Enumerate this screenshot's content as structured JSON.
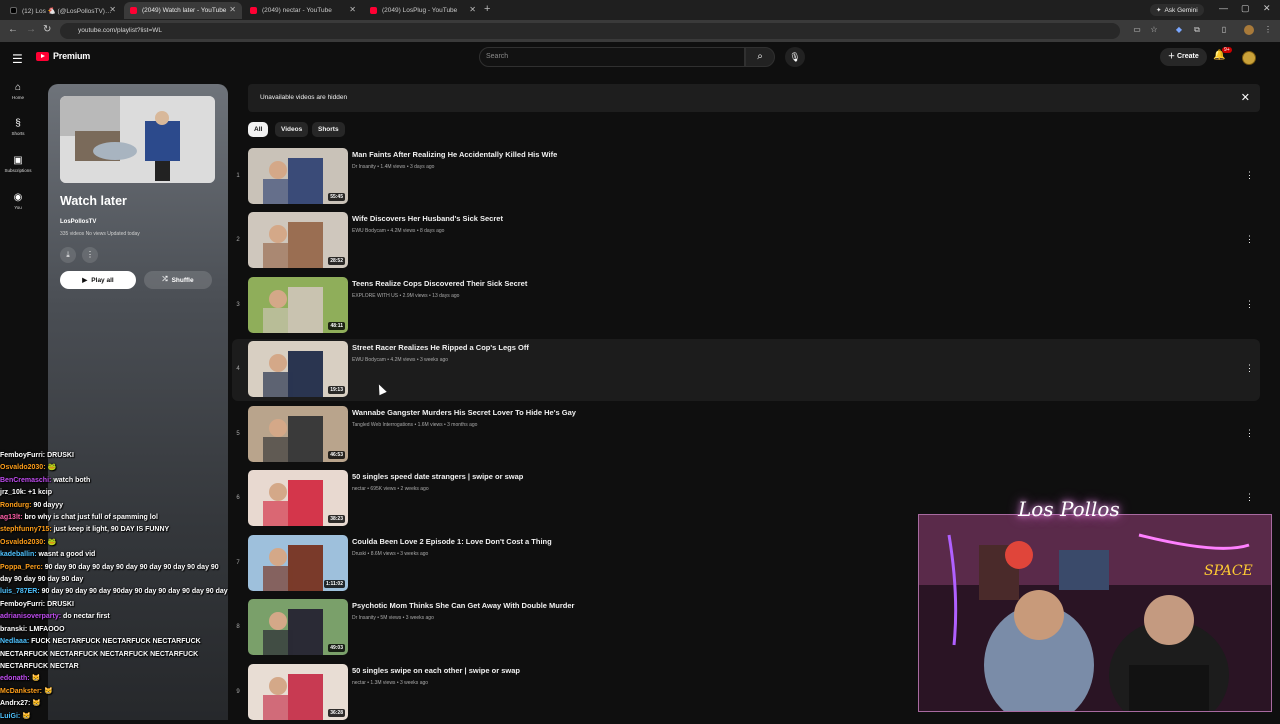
{
  "browser": {
    "tabs": [
      {
        "label": "(12) Los 🐔 (@LosPollosTV) / X",
        "favicon_color": "#000000",
        "active": false
      },
      {
        "label": "(2049) Watch later - YouTube",
        "favicon_color": "#ff0033",
        "active": true
      },
      {
        "label": "(2049) nectar - YouTube",
        "favicon_color": "#ff0033",
        "active": false
      },
      {
        "label": "(2049) LosPlug - YouTube",
        "favicon_color": "#ff0033",
        "active": false
      }
    ],
    "new_tab": "+",
    "ask_gemini": "Ask Gemini",
    "url": "youtube.com/playlist?list=WL"
  },
  "youtube": {
    "logo_text": "Premium",
    "search_placeholder": "Search",
    "create_label": "Create",
    "notifications_badge": "9+",
    "guide": [
      {
        "icon": "home-icon",
        "label": "Home"
      },
      {
        "icon": "shorts-icon",
        "label": "Shorts"
      },
      {
        "icon": "subscriptions-icon",
        "label": "Subscriptions"
      },
      {
        "icon": "you-icon",
        "label": "You"
      }
    ]
  },
  "playlist": {
    "title": "Watch later",
    "owner": "LosPollosTV",
    "meta": "335 videos  No views  Updated today",
    "play_all": "Play all",
    "shuffle": "Shuffle"
  },
  "banner": {
    "text": "Unavailable videos are hidden"
  },
  "chips": [
    "All",
    "Videos",
    "Shorts"
  ],
  "videos": [
    {
      "index": "1",
      "title": "Man Faints After Realizing He Accidentally Killed His Wife",
      "meta": "Dr Insanity • 1.4M views • 3 days ago",
      "duration": "55:45",
      "thumb_colors": [
        "#c9c2b8",
        "#3a4b78"
      ]
    },
    {
      "index": "2",
      "title": "Wife Discovers Her Husband's Sick Secret",
      "meta": "EWU Bodycam • 4.2M views • 8 days ago",
      "duration": "28:52",
      "thumb_colors": [
        "#cfc7bd",
        "#9a6e52"
      ]
    },
    {
      "index": "3",
      "title": "Teens Realize Cops Discovered Their Sick Secret",
      "meta": "EXPLORE WITH US • 2.9M views • 13 days ago",
      "duration": "48:11",
      "thumb_colors": [
        "#8fae5a",
        "#c9c3b0"
      ]
    },
    {
      "index": "4",
      "title": "Street Racer Realizes He Ripped a Cop's Legs Off",
      "meta": "EWU Bodycam • 4.2M views • 3 weeks ago",
      "duration": "19:13",
      "thumb_colors": [
        "#d8cfc2",
        "#2a3550"
      ]
    },
    {
      "index": "5",
      "title": "Wannabe Gangster Murders His Secret Lover To Hide He's Gay",
      "meta": "Tangled Web Interrogations • 1.6M views • 3 months ago",
      "duration": "46:53",
      "thumb_colors": [
        "#b9a48c",
        "#3a3a3a"
      ]
    },
    {
      "index": "6",
      "title": "50 singles speed date strangers | swipe or swap",
      "meta": "nectar • 695K views • 2 weeks ago",
      "duration": "38:23",
      "thumb_colors": [
        "#e8d9d0",
        "#d4364b"
      ]
    },
    {
      "index": "7",
      "title": "Coulda Been Love 2 Episode 1: Love Don't Cost a Thing",
      "meta": "Druski • 8.6M views • 3 weeks ago",
      "duration": "1:11:02",
      "thumb_colors": [
        "#9ec0dc",
        "#7a3a2a"
      ]
    },
    {
      "index": "8",
      "title": "Psychotic Mom Thinks She Can Get Away With Double Murder",
      "meta": "Dr Insanity • 5M views • 3 weeks ago",
      "duration": "49:03",
      "thumb_colors": [
        "#7aa06a",
        "#2a2a35"
      ]
    },
    {
      "index": "9",
      "title": "50 singles swipe on each other | swipe or swap",
      "meta": "nectar • 1.3M views • 3 weeks ago",
      "duration": "36:28",
      "thumb_colors": [
        "#e8ddd4",
        "#c83a52"
      ]
    }
  ],
  "chat": [
    {
      "user": "FemboyFurri:",
      "color": "#ffffff",
      "msg": "DRUSKI"
    },
    {
      "user": "Osvaldo2030:",
      "color": "#ff9f1a",
      "msg": "🐸"
    },
    {
      "user": "BenCremaschi:",
      "color": "#c04cf0",
      "msg": "watch both"
    },
    {
      "user": "jrz_10k:",
      "color": "#ffffff",
      "msg": "+1 kcip"
    },
    {
      "user": "Rondurg:",
      "color": "#ff9f1a",
      "msg": "90 dayyy"
    },
    {
      "user": "ag13lt:",
      "color": "#ff5fa8",
      "msg": "bro why is chat just full of spamming lol"
    },
    {
      "user": "stephfunny715:",
      "color": "#ff9f1a",
      "msg": "just keep it light, 90 DAY IS FUNNY"
    },
    {
      "user": "Osvaldo2030:",
      "color": "#ff9f1a",
      "msg": "🐸"
    },
    {
      "user": "kadeballin:",
      "color": "#4fc3ff",
      "msg": "wasnt a good vid"
    },
    {
      "user": "Poppa_Perc:",
      "color": "#ff9f1a",
      "msg": "90 day 90 day 90 day 90 day 90 day 90 day 90 day 90 day 90 day 90 day 90 day"
    },
    {
      "user": "luis_787ER:",
      "color": "#4fc3ff",
      "msg": "90 day 90 day 90 day 90day 90 day 90 day 90 day 90 day"
    },
    {
      "user": "FemboyFurri:",
      "color": "#ffffff",
      "msg": "DRUSKI"
    },
    {
      "user": "adrianisoverparty:",
      "color": "#c04cf0",
      "msg": "do nectar first"
    },
    {
      "user": "branski:",
      "color": "#ffffff",
      "msg": "LMFAOOO"
    },
    {
      "user": "Nedlaaa:",
      "color": "#4fc3ff",
      "msg": "FUCK NECTARFUCK NECTARFUCK NECTARFUCK NECTARFUCK NECTARFUCK NECTARFUCK NECTARFUCK NECTARFUCK NECTAR"
    },
    {
      "user": "edonath:",
      "color": "#c04cf0",
      "msg": "😸"
    },
    {
      "user": "McDankster:",
      "color": "#ff9f1a",
      "msg": "😸"
    },
    {
      "user": "Andrx27:",
      "color": "#ffffff",
      "msg": "😸"
    },
    {
      "user": "LuiGi:",
      "color": "#4fc3ff",
      "msg": "😸"
    }
  ],
  "webcam": {
    "neon_sign": "Los Pollos"
  }
}
